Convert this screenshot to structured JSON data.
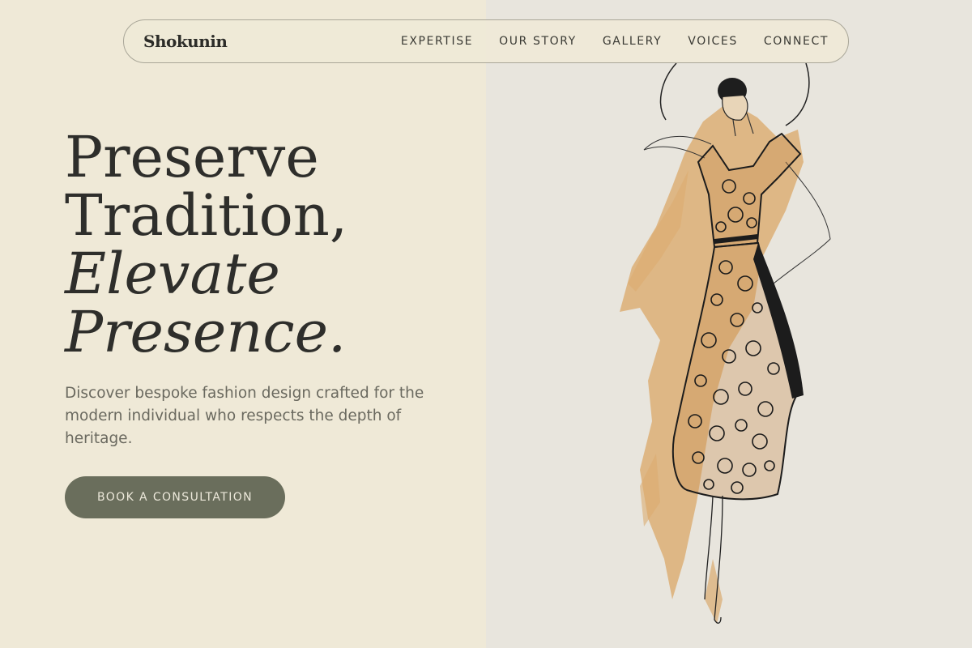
{
  "brand": {
    "logo": "Shokunin"
  },
  "nav": {
    "links": [
      "EXPERTISE",
      "OUR STORY",
      "GALLERY",
      "VOICES",
      "CONNECT"
    ]
  },
  "hero": {
    "title_lines": [
      "Preserve",
      "Tradition,",
      "Elevate",
      "Presence."
    ],
    "description": "Discover bespoke fashion design crafted for the modern individual who respects the depth of heritage.",
    "cta_label": "BOOK A CONSULTATION"
  },
  "image": {
    "subject": "fashion-sketch-woman-in-lace-dress"
  },
  "colors": {
    "background": "#efe9d7",
    "button": "#6a6e5c",
    "text": "#2e2e2b",
    "accent_wash": "#d9a15d"
  }
}
